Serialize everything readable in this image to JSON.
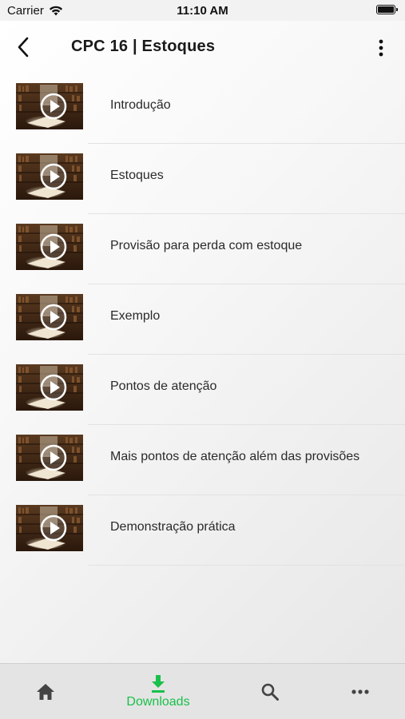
{
  "status_bar": {
    "carrier": "Carrier",
    "time": "11:10 AM"
  },
  "header": {
    "title": "CPC 16 | Estoques",
    "back_icon": "chevron-left-icon",
    "menu_icon": "more-vertical-icon"
  },
  "lessons": [
    {
      "title": "Introdução"
    },
    {
      "title": "Estoques"
    },
    {
      "title": "Provisão para perda com estoque"
    },
    {
      "title": "Exemplo"
    },
    {
      "title": "Pontos de atenção"
    },
    {
      "title": "Mais pontos de atenção além das provisões"
    },
    {
      "title": "Demonstração prática"
    }
  ],
  "tab_bar": {
    "active_color": "#19c04a",
    "inactive_color": "#444444",
    "tabs": [
      {
        "icon": "home-icon",
        "label": ""
      },
      {
        "icon": "download-icon",
        "label": "Downloads",
        "active": true
      },
      {
        "icon": "search-icon",
        "label": ""
      },
      {
        "icon": "more-horizontal-icon",
        "label": ""
      }
    ]
  }
}
